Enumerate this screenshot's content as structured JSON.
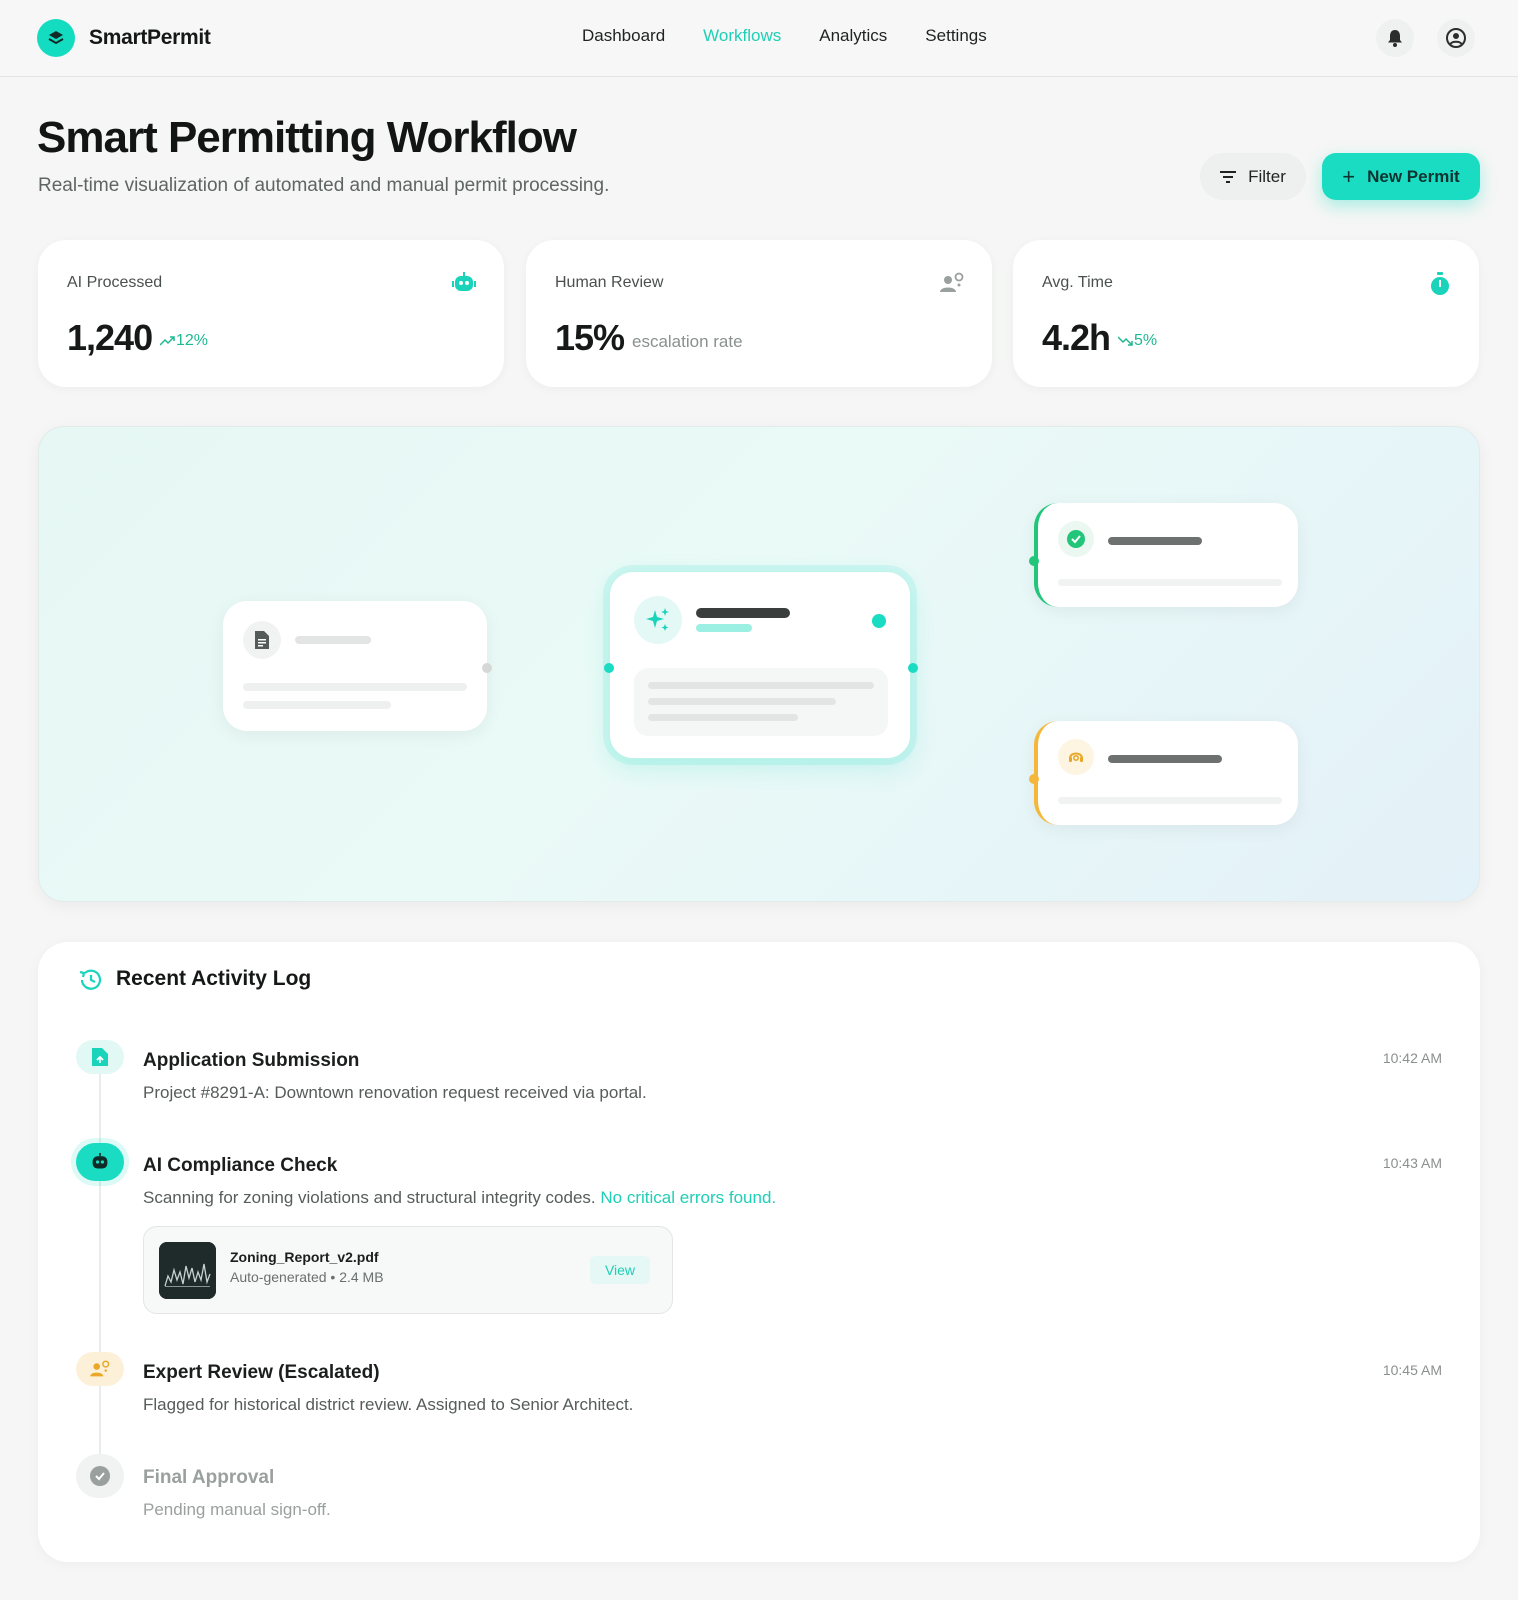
{
  "app": {
    "name": "SmartPermit"
  },
  "nav": {
    "items": [
      "Dashboard",
      "Workflows",
      "Analytics",
      "Settings"
    ],
    "active": "Workflows"
  },
  "header": {
    "title": "Smart Permitting Workflow",
    "subtitle": "Real-time visualization of automated and manual permit processing.",
    "filter_label": "Filter",
    "new_label": "New Permit"
  },
  "stats": [
    {
      "label": "AI Processed",
      "value": "1,240",
      "trend": "12%",
      "icon": "robot-icon"
    },
    {
      "label": "Human Review",
      "value": "15%",
      "note": "escalation rate",
      "icon": "person-gear-icon"
    },
    {
      "label": "Avg. Time",
      "value": "4.2h",
      "trend": "5%",
      "icon": "stopwatch-icon"
    }
  ],
  "log": {
    "title": "Recent Activity Log",
    "items": [
      {
        "title": "Application Submission",
        "desc": "Project #8291-A: Downtown renovation request received via portal.",
        "time": "10:42 AM",
        "icon": "file-upload-icon"
      },
      {
        "title": "AI Compliance Check",
        "desc": "Scanning for zoning violations and structural integrity codes.",
        "highlight": "No critical errors found.",
        "time": "10:43 AM",
        "icon": "robot-icon",
        "attachment": {
          "name": "Zoning_Report_v2.pdf",
          "meta": "Auto-generated • 2.4 MB",
          "action": "View"
        }
      },
      {
        "title": "Expert Review (Escalated)",
        "desc": "Flagged for historical district review. Assigned to Senior Architect.",
        "time": "10:45 AM",
        "icon": "person-gear-icon"
      },
      {
        "title": "Final Approval",
        "desc": "Pending manual sign-off.",
        "time": "",
        "icon": "check-circle-icon"
      }
    ]
  },
  "colors": {
    "accent": "#19dcc3",
    "success": "#1fb892",
    "warning": "#f5b73b",
    "muted": "#8a908e"
  }
}
